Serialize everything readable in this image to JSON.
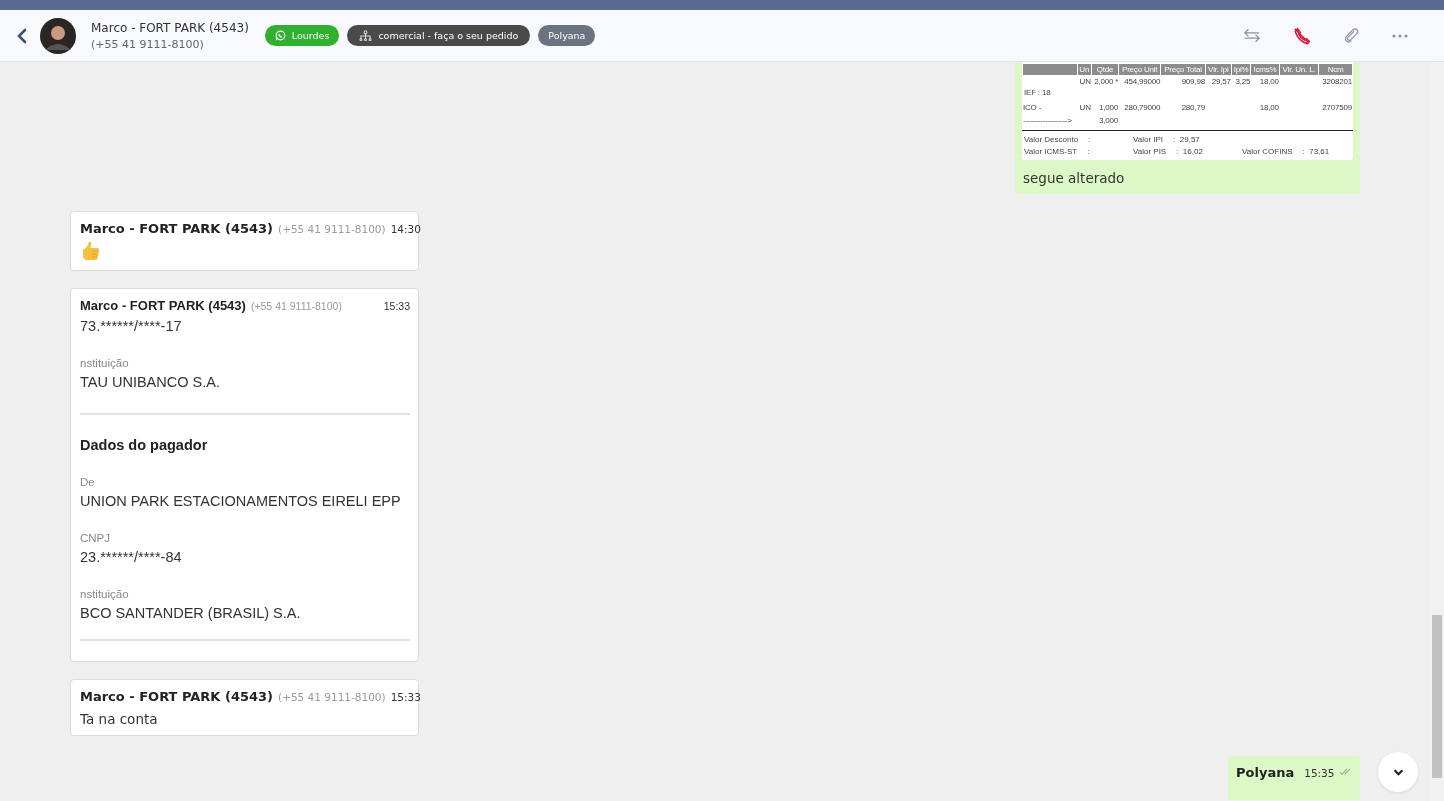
{
  "header": {
    "contact_name": "Marco - FORT PARK (4543)",
    "contact_phone": "(+55 41 9111-8100)",
    "tags": [
      {
        "kind": "whatsapp",
        "label": "Lourdes"
      },
      {
        "kind": "sector",
        "label": "comercial - faça o seu pedido"
      },
      {
        "kind": "user",
        "label": "Polyana"
      }
    ]
  },
  "messages": [
    {
      "kind": "document",
      "caption": "segue alterado",
      "document": {
        "columns": [
          "",
          "Un",
          "Qtde",
          "Preço Unit",
          "Preço Total",
          "Vlr. Ipi",
          "Ipi%",
          "Icms%",
          "Vlr. Un. L.",
          "Ncm"
        ],
        "rows": [
          {
            "cells": [
              "",
              "UN",
              "2,000 *",
              "454,99000",
              "909,98",
              "29,57",
              "3,25",
              "18,00",
              "",
              "3208201"
            ],
            "note": "IEF : 18"
          },
          {
            "cells": [
              "ICO -",
              "UN",
              "1,000",
              "280,79000",
              "280,79",
              "",
              "",
              "18,00",
              "",
              "2707509"
            ]
          },
          {
            "cells": [
              "------------------>",
              "",
              "3,000",
              "",
              "",
              "",
              "",
              "",
              "",
              ""
            ]
          }
        ],
        "totals": [
          {
            "items": [
              {
                "label": "Valor Desconto",
                "value": ":"
              },
              {
                "label": "Valor ICMS-ST",
                "value": ":"
              }
            ]
          },
          {
            "items": [
              {
                "label": "Valor IPI",
                "value": ":  29,57"
              },
              {
                "label": "Valor PIS",
                "value": ":  16,02"
              }
            ]
          },
          {
            "items": [
              {
                "label": "Valor COFINS",
                "value": ":  73,61"
              }
            ]
          }
        ]
      }
    },
    {
      "kind": "emoji",
      "sender": "Marco - FORT PARK (4543)",
      "phone": "(+55 41 9111-8100)",
      "time": "14:30"
    },
    {
      "kind": "receipt",
      "sender": "Marco - FORT PARK (4543)",
      "phone": "(+55 41 9111-8100)",
      "time": "15:33",
      "lines": [
        {
          "kind": "value",
          "text": "73.******/****-17"
        },
        {
          "kind": "label",
          "text": "nstituição"
        },
        {
          "kind": "value",
          "text": "TAU UNIBANCO S.A."
        },
        {
          "kind": "rule"
        },
        {
          "kind": "heading",
          "text": "Dados do pagador"
        },
        {
          "kind": "label",
          "text": "De"
        },
        {
          "kind": "value",
          "text": "UNION PARK ESTACIONAMENTOS EIRELI EPP"
        },
        {
          "kind": "label",
          "text": "CNPJ"
        },
        {
          "kind": "value",
          "text": "23.******/****-84"
        },
        {
          "kind": "label",
          "text": "nstituição"
        },
        {
          "kind": "value",
          "text": "BCO SANTANDER (BRASIL) S.A."
        },
        {
          "kind": "rule"
        }
      ]
    },
    {
      "kind": "text",
      "sender": "Marco - FORT PARK (4543)",
      "phone": "(+55 41 9111-8100)",
      "time": "15:33",
      "text": "Ta na conta"
    },
    {
      "kind": "partial",
      "sender": "Polyana",
      "time": "15:35",
      "read": true
    }
  ]
}
